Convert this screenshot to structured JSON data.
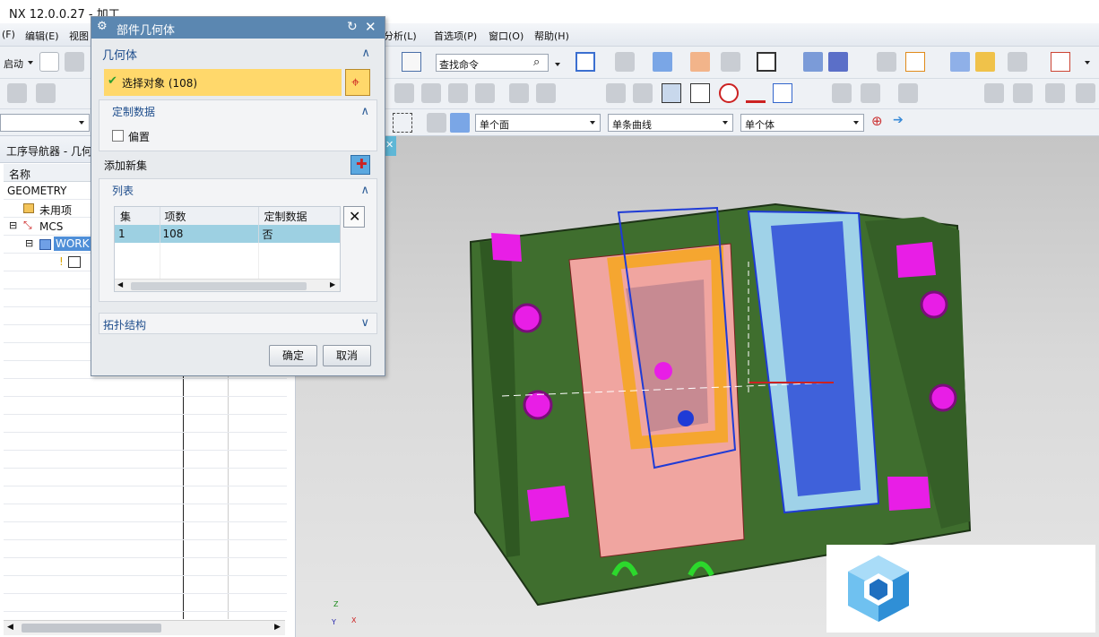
{
  "window": {
    "title": "NX 12.0.0.27 - 加工"
  },
  "menubar": {
    "items": [
      "(F)",
      "编辑(E)",
      "视图",
      "分析(L)",
      "首选项(P)",
      "窗口(O)",
      "帮助(H)"
    ]
  },
  "toolbar": {
    "start_label": "启动",
    "search": {
      "value": "查找命令"
    },
    "filters": {
      "face": "单个面",
      "curve": "单条曲线",
      "body": "单个体"
    }
  },
  "navigator": {
    "title": "工序导航器 - 几何",
    "column_header": "名称",
    "nodes": [
      {
        "label": "GEOMETRY",
        "icon": "none"
      },
      {
        "label": "未用项",
        "icon": "folder-icon"
      },
      {
        "label": "MCS",
        "icon": "mcs-icon"
      },
      {
        "label": "WORK",
        "icon": "workpiece-icon"
      }
    ]
  },
  "dialog": {
    "title": "部件几何体",
    "geometry_section": "几何体",
    "select_object": "选择对象 (108)",
    "custom_data_section": "定制数据",
    "offset_label": "偏置",
    "add_new_set": "添加新集",
    "list_section": "列表",
    "table": {
      "headers": [
        "集",
        "项数",
        "定制数据"
      ],
      "rows": [
        [
          "1",
          "108",
          "否"
        ]
      ]
    },
    "topology_section": "拓扑结构",
    "ok_label": "确定",
    "cancel_label": "取消"
  },
  "viewport": {
    "triad_labels": [
      "Z",
      "X",
      "Y"
    ]
  },
  "colors": {
    "dialog_title": "#5b87b1",
    "select_highlight": "#ffd86b",
    "mold_green": "#3f6e2e",
    "magenta": "#e81ee6",
    "blue": "#1f3bd6",
    "orange": "#f5a623",
    "pink": "#f0a5a0"
  }
}
